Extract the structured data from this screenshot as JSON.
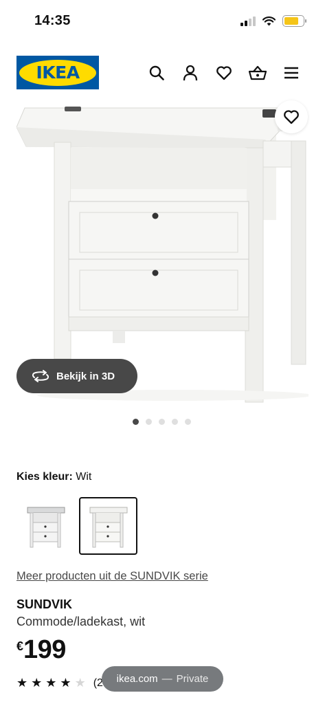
{
  "status_bar": {
    "time": "14:35",
    "battery_color": "#f5c518"
  },
  "header": {
    "logo_text": "IKEA",
    "brand_blue": "#0058a3",
    "brand_yellow": "#ffdb00",
    "icons": [
      "search-icon",
      "user-icon",
      "heart-icon",
      "basket-icon",
      "menu-icon"
    ]
  },
  "gallery": {
    "view_3d_label": "Bekijk in 3D",
    "image_count": 5,
    "active_index": 0
  },
  "color_selector": {
    "label": "Kies kleur:",
    "value": "Wit"
  },
  "series_link": "Meer producten uit de SUNDVIK serie",
  "product": {
    "name": "SUNDVIK",
    "description": "Commode/ladekast, wit",
    "currency": "€",
    "price": "199",
    "rating_stars": 4,
    "rating_max": 5,
    "review_count": "(2"
  },
  "browser_pill": {
    "domain": "ikea.com",
    "separator": "—",
    "mode": "Private"
  }
}
